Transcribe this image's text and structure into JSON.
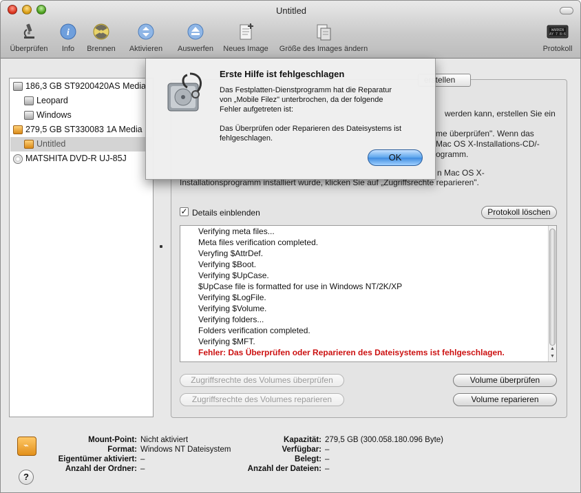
{
  "window": {
    "title": "Untitled"
  },
  "toolbar": {
    "items": [
      {
        "label": "Überprüfen",
        "icon": "microscope-icon"
      },
      {
        "label": "Info",
        "icon": "info-icon"
      },
      {
        "label": "Brennen",
        "icon": "burn-icon"
      },
      {
        "label": "Aktivieren",
        "icon": "mount-icon"
      },
      {
        "label": "Auswerfen",
        "icon": "eject-icon"
      },
      {
        "label": "Neues Image",
        "icon": "new-image-icon"
      },
      {
        "label": "Größe des Images ändern",
        "icon": "resize-image-icon"
      },
      {
        "label": "Protokoll",
        "icon": "log-icon",
        "badge": "WARNIN\nAY 7 8:6"
      }
    ]
  },
  "sidebar": {
    "items": [
      {
        "label": "186,3 GB ST9200420AS Media",
        "type": "disk"
      },
      {
        "label": "Leopard",
        "type": "volume"
      },
      {
        "label": "Windows",
        "type": "volume"
      },
      {
        "label": "279,5 GB ST330083 1A Media",
        "type": "disk-orange"
      },
      {
        "label": "Untitled",
        "type": "volume-orange",
        "selected": true
      },
      {
        "label": "MATSHITA DVD-R UJ-85J",
        "type": "optical"
      }
    ]
  },
  "main": {
    "tab_fragment": "erstellen",
    "info_lines": [
      "werden kann, erstellen Sie ein",
      "me überprüfen\". Wenn das",
      "Mac OS X-Installations-CD/-",
      "ogramm.",
      "n Mac OS X-",
      "Installationsprogramm installiert wurde, klicken Sie auf „Zugriffsrechte reparieren\"."
    ],
    "details_checkbox_label": "Details einblenden",
    "details_checked": true,
    "clear_log_button": "Protokoll löschen",
    "log": [
      "Verifying meta files...",
      "Meta files verification completed.",
      "Veryfing $AttrDef.",
      "Verifying $Boot.",
      "Verifying $UpCase.",
      "$UpCase file is formatted for use in Windows NT/2K/XP",
      "Verifying $LogFile.",
      "Verifying $Volume.",
      "Verifying folders...",
      "Folders verification completed.",
      "Verifying $MFT."
    ],
    "log_error": "Fehler: Das Überprüfen oder Reparieren des Dateisystems ist fehlgeschlagen.",
    "buttons": {
      "verify_permissions": "Zugriffsrechte des Volumes überprüfen",
      "repair_permissions": "Zugriffsrechte des Volumes reparieren",
      "verify_volume": "Volume überprüfen",
      "repair_volume": "Volume reparieren"
    }
  },
  "bottom": {
    "left": [
      {
        "label": "Mount-Point:",
        "value": "Nicht aktiviert"
      },
      {
        "label": "Format:",
        "value": "Windows NT Dateisystem"
      },
      {
        "label": "Eigentümer aktiviert:",
        "value": "–"
      },
      {
        "label": "Anzahl der Ordner:",
        "value": "–"
      }
    ],
    "right": [
      {
        "label": "Kapazität:",
        "value": "279,5 GB (300.058.180.096 Byte)"
      },
      {
        "label": "Verfügbar:",
        "value": "–"
      },
      {
        "label": "Belegt:",
        "value": "–"
      },
      {
        "label": "Anzahl der Dateien:",
        "value": "–"
      }
    ],
    "help": "?"
  },
  "dialog": {
    "title": "Erste Hilfe ist fehlgeschlagen",
    "message_lines": [
      "Das Festplatten-Dienstprogramm hat die Reparatur",
      "von „Mobile Filez\" unterbrochen, da der folgende",
      "Fehler aufgetreten ist:",
      "",
      "Das Überprüfen oder Reparieren des Dateisystems ist",
      "fehlgeschlagen."
    ],
    "ok_label": "OK"
  },
  "colors": {
    "error": "#cc1111",
    "ok_button": "#5aa4ec",
    "selection": "#d4d4d4"
  }
}
